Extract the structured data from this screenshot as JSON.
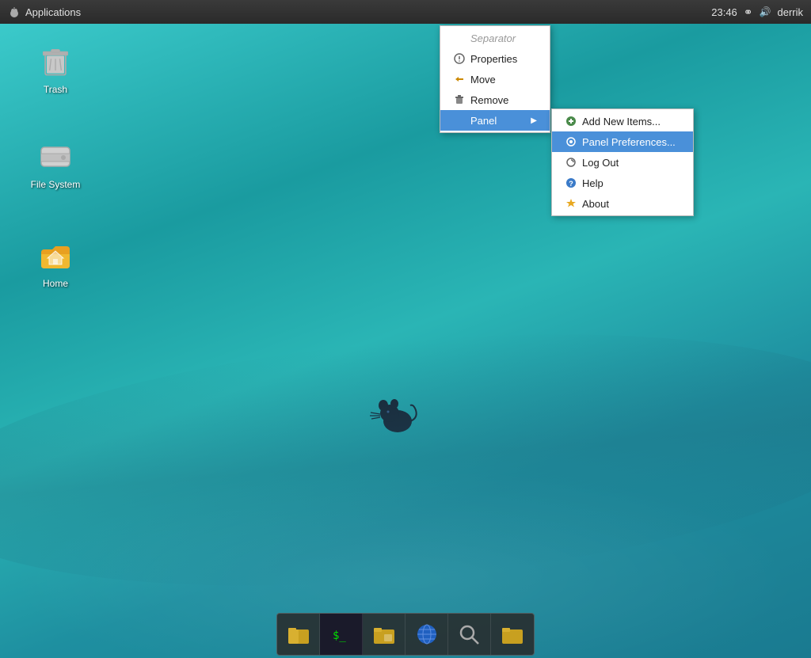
{
  "panel": {
    "app_menu_label": "Applications",
    "clock": "23:46",
    "user": "derrik",
    "bluetooth_icon": "bluetooth-icon",
    "volume_icon": "volume-icon"
  },
  "desktop_icons": [
    {
      "id": "trash",
      "label": "Trash",
      "type": "trash"
    },
    {
      "id": "filesystem",
      "label": "File System",
      "type": "drive"
    },
    {
      "id": "home",
      "label": "Home",
      "type": "home"
    }
  ],
  "context_menu": {
    "items": [
      {
        "id": "separator",
        "label": "Separator",
        "icon": "",
        "type": "separator"
      },
      {
        "id": "properties",
        "label": "Properties",
        "icon": "⚙",
        "type": "item"
      },
      {
        "id": "move",
        "label": "Move",
        "icon": "➜",
        "type": "item"
      },
      {
        "id": "remove",
        "label": "Remove",
        "icon": "🗑",
        "type": "item"
      },
      {
        "id": "panel",
        "label": "Panel",
        "icon": "",
        "type": "submenu"
      }
    ],
    "submenu_items": [
      {
        "id": "add-new-items",
        "label": "Add New Items...",
        "icon": "➕",
        "active": false
      },
      {
        "id": "panel-preferences",
        "label": "Panel Preferences...",
        "icon": "⚙",
        "active": true
      },
      {
        "id": "log-out",
        "label": "Log Out",
        "icon": "⏻",
        "active": false
      },
      {
        "id": "help",
        "label": "Help",
        "icon": "❓",
        "active": false
      },
      {
        "id": "about",
        "label": "About",
        "icon": "⭐",
        "active": false
      }
    ]
  },
  "taskbar": {
    "items": [
      {
        "id": "files",
        "icon": "📁"
      },
      {
        "id": "terminal",
        "icon": "$"
      },
      {
        "id": "files2",
        "icon": "📂"
      },
      {
        "id": "browser",
        "icon": "🌐"
      },
      {
        "id": "search",
        "icon": "🔍"
      },
      {
        "id": "files3",
        "icon": "📁"
      }
    ]
  }
}
